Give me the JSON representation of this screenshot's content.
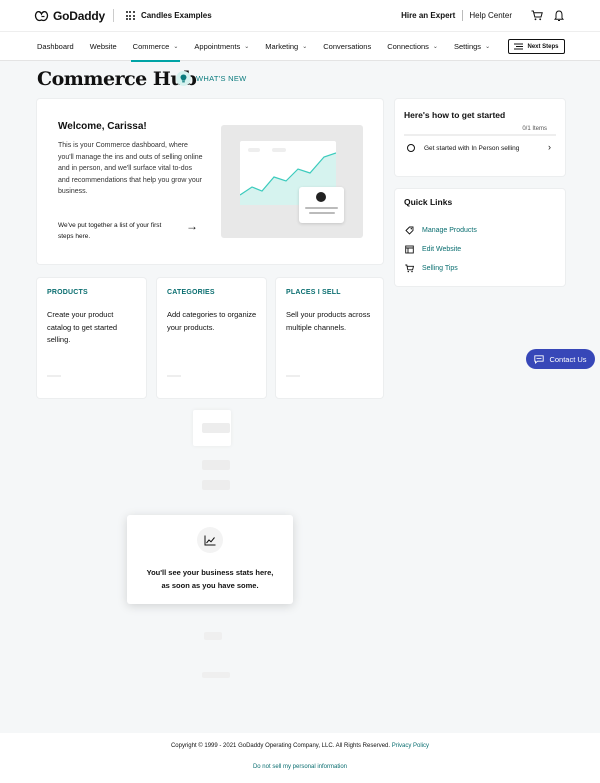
{
  "topbar": {
    "logo_text": "GoDaddy",
    "site_name": "Candles Examples",
    "hire_expert": "Hire an Expert",
    "help_center": "Help Center"
  },
  "nav": {
    "items": [
      {
        "label": "Dashboard"
      },
      {
        "label": "Website"
      },
      {
        "label": "Commerce",
        "active": true
      },
      {
        "label": "Appointments"
      },
      {
        "label": "Marketing"
      },
      {
        "label": "Conversations"
      },
      {
        "label": "Connections"
      },
      {
        "label": "Settings"
      }
    ],
    "next_steps": "Next Steps"
  },
  "header": {
    "title": "Commerce Hub",
    "whats_new": "WHAT'S NEW"
  },
  "welcome": {
    "title": "Welcome, Carissa!",
    "description": "This is your Commerce dashboard, where you'll manage the ins and outs of selling online and in person, and we'll surface vital to-dos and recommendations that help you grow your business.",
    "steps_text": "We've put together a list of your first steps here."
  },
  "cards": [
    {
      "label": "PRODUCTS",
      "text": "Create your product catalog to get started selling."
    },
    {
      "label": "CATEGORIES",
      "text": "Add categories to organize your products."
    },
    {
      "label": "PLACES I SELL",
      "text": "Sell your products across multiple channels."
    }
  ],
  "getting_started": {
    "title": "Here's how to get started",
    "count": "0/1 Items",
    "task": "Get started with In Person selling"
  },
  "quick_links": {
    "title": "Quick Links",
    "items": [
      {
        "label": "Manage Products",
        "icon": "tag-icon"
      },
      {
        "label": "Edit Website",
        "icon": "website-icon"
      },
      {
        "label": "Selling Tips",
        "icon": "cart-icon"
      }
    ]
  },
  "contact": {
    "label": "Contact Us"
  },
  "stats": {
    "message_line1": "You'll see your business stats here,",
    "message_line2": "as soon as you have some."
  },
  "footer": {
    "copyright": "Copyright © 1999 - 2021 GoDaddy Operating Company, LLC. All Rights Reserved.",
    "privacy": "Privacy Policy",
    "do_not_sell": "Do not sell my personal information"
  },
  "colors": {
    "accent": "#00a4a6",
    "link": "#0a6e70",
    "contact_bg": "#3747b8"
  }
}
